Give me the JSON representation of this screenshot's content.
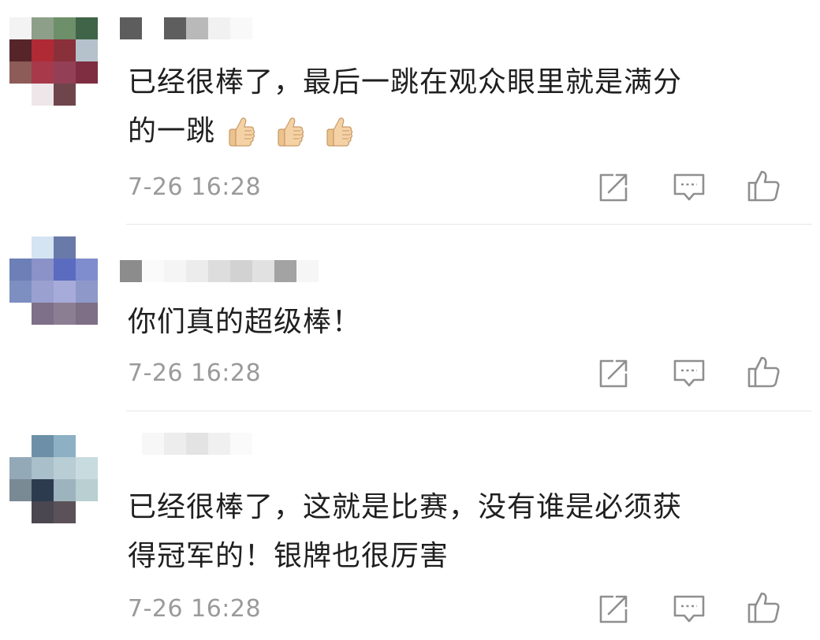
{
  "comments": [
    {
      "text_line1": "已经很棒了，最后一跳在观众眼里就是满分",
      "text_line2": "的一跳",
      "emoji": [
        "thumbs-up",
        "thumbs-up",
        "thumbs-up"
      ],
      "time": "7-26 16:28"
    },
    {
      "text_line1": "你们真的超级棒！",
      "time": "7-26 16:28"
    },
    {
      "text_line1": "已经很棒了，这就是比赛，没有谁是必须获",
      "text_line2": "得冠军的！银牌也很厉害",
      "time": "7-26 16:28"
    }
  ],
  "actions": {
    "share_icon": "share-icon",
    "reply_icon": "comment-icon",
    "like_icon": "thumbs-up-icon"
  },
  "colors": {
    "text": "#1f1f1f",
    "meta": "#9a9a9a",
    "divider": "#e6e6e6",
    "icon": "#9a9a9a",
    "emoji": "#f2c98f"
  }
}
